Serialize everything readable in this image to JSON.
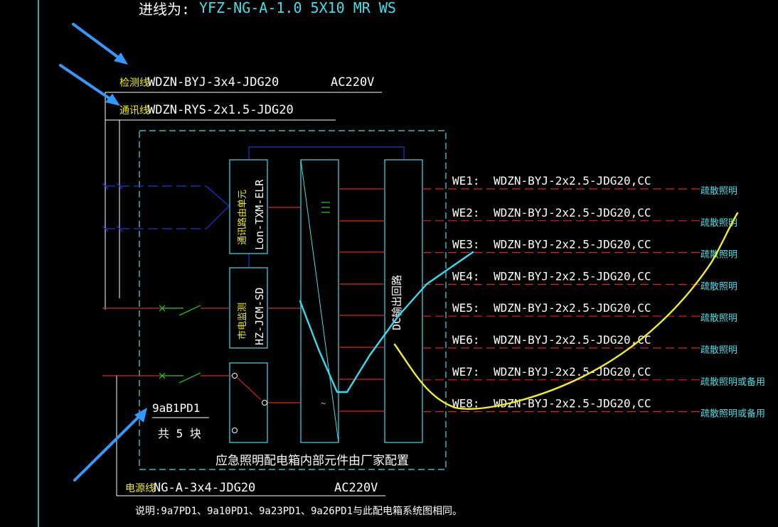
{
  "header": {
    "label": "进线为:",
    "value": "YFZ-NG-A-1.0 5X10 MR WS"
  },
  "incoming": {
    "detect": {
      "label": "检测线",
      "value": "WDZN-BYJ-3x4-JDG20",
      "voltage": "AC220V"
    },
    "comm": {
      "label": "通讯线",
      "value": "WDZN-RYS-2x1.5-JDG20"
    },
    "power": {
      "label": "电源线",
      "value": "NG-A-3x4-JDG20",
      "voltage": "AC220V"
    }
  },
  "modules": {
    "comm_unit": {
      "line1": "通讯路由单元",
      "line2": "Lon-TXM-ELR"
    },
    "monitor": {
      "line1": "市电监测",
      "line2": "HZ-JCM-SD"
    },
    "dc_output": "DC输出回路"
  },
  "box": {
    "id": "9aB1PD1",
    "count": "共 5 块",
    "note": "应急照明配电箱内部元件由厂家配置"
  },
  "circuits": [
    {
      "id": "WE1:",
      "cable": "WDZN-BYJ-2x2.5-JDG20,CC",
      "use": "疏散照明"
    },
    {
      "id": "WE2:",
      "cable": "WDZN-BYJ-2x2.5-JDG20,CC",
      "use": "疏散照明"
    },
    {
      "id": "WE3:",
      "cable": "WDZN-BYJ-2x2.5-JDG20,CC",
      "use": "疏散照明"
    },
    {
      "id": "WE4:",
      "cable": "WDZN-BYJ-2x2.5-JDG20,CC",
      "use": "疏散照明"
    },
    {
      "id": "WE5:",
      "cable": "WDZN-BYJ-2x2.5-JDG20,CC",
      "use": "疏散照明"
    },
    {
      "id": "WE6:",
      "cable": "WDZN-BYJ-2x2.5-JDG20,CC",
      "use": "疏散照明"
    },
    {
      "id": "WE7:",
      "cable": "WDZN-BYJ-2x2.5-JDG20,CC",
      "use": "疏散照明或备用"
    },
    {
      "id": "WE8:",
      "cable": "WDZN-BYJ-2x2.5-JDG20,CC",
      "use": "疏散照明或备用"
    }
  ],
  "footnote": "说明:9a7PD1、9a10PD1、9a23PD1、9a26PD1与此配电箱系统图相同。",
  "colors": {
    "background": "#000000",
    "text_white": "#ffffff",
    "text_cyan": "#40e0e8",
    "text_yellow": "#f0f000",
    "red_line": "#e02020",
    "blue_line": "#2030e0",
    "green_line": "#20d020",
    "cyan_frame": "#40e0e8",
    "annotation_arrow": "#3399ff",
    "annotation_cyan": "#30e0f0",
    "annotation_yellow": "#f0f020"
  }
}
